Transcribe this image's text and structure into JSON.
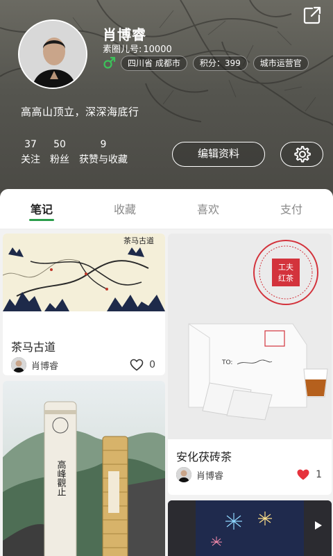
{
  "profile": {
    "name": "肖博睿",
    "uid_label": "素圈儿号:",
    "uid": "10000",
    "location": "四川省 成都市",
    "points": "积分：399",
    "role": "城市运营官",
    "bio": "高高山顶立，深深海底行"
  },
  "stats": [
    {
      "value": "37",
      "label": "关注"
    },
    {
      "value": "50",
      "label": "粉丝"
    },
    {
      "value": "9",
      "label": "获赞与收藏"
    }
  ],
  "actions": {
    "edit_label": "编辑资料"
  },
  "tabs": [
    {
      "label": "笔记"
    },
    {
      "label": "收藏"
    },
    {
      "label": "喜欢"
    },
    {
      "label": "支付"
    }
  ],
  "cards": [
    {
      "title": "茶马古道",
      "map_title": "茶马古道",
      "author": "肖博睿",
      "likes": "0",
      "liked": false
    },
    {
      "title": "安化茯砖茶",
      "author": "肖博睿",
      "likes": "1",
      "liked": true,
      "stamp_lines": [
        "工夫",
        "红茶"
      ],
      "box_label": "TO:"
    },
    {
      "title": "",
      "package_text": "高峰觀止"
    },
    {
      "title": ""
    }
  ],
  "colors": {
    "accent": "#2a9d4a",
    "like_red": "#e6323c",
    "gender": "#3cc25a"
  }
}
